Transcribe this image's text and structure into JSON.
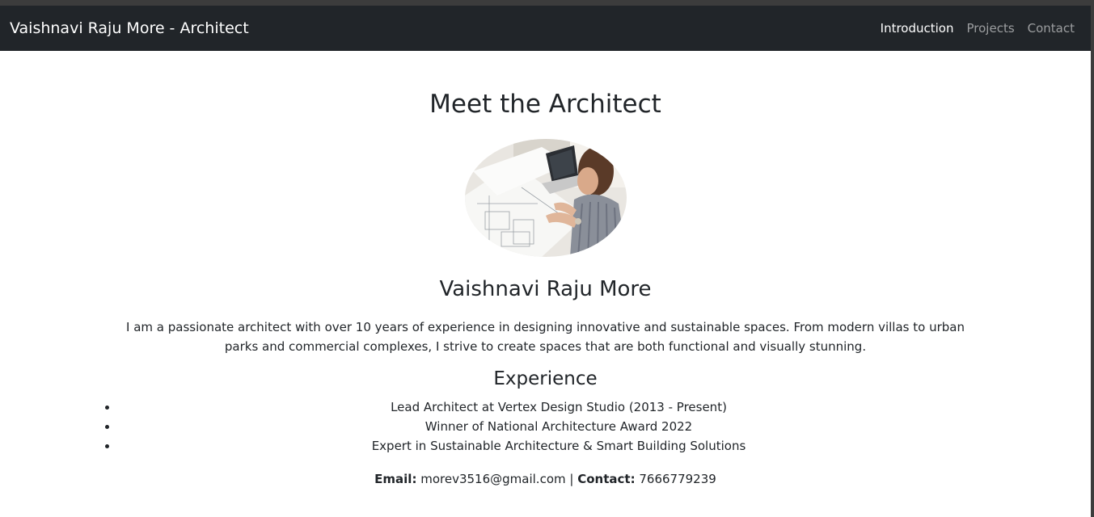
{
  "navbar": {
    "brand": "Vaishnavi Raju More - Architect",
    "links": [
      {
        "label": "Introduction",
        "active": true
      },
      {
        "label": "Projects",
        "active": false
      },
      {
        "label": "Contact",
        "active": false
      }
    ]
  },
  "main": {
    "title": "Meet the Architect",
    "photo_icon": "architect-photo",
    "name": "Vaishnavi Raju More",
    "bio": "I am a passionate architect with over 10 years of experience in designing innovative and sustainable spaces. From modern villas to urban parks and commercial complexes, I strive to create spaces that are both functional and visually stunning.",
    "experience_title": "Experience",
    "experience": [
      "Lead Architect at Vertex Design Studio (2013 - Present)",
      "Winner of National Architecture Award 2022",
      "Expert in Sustainable Architecture & Smart Building Solutions"
    ],
    "contact": {
      "email_label": "Email:",
      "email": "morev3516@gmail.com",
      "separator": "|",
      "phone_label": "Contact:",
      "phone": "7666779239"
    }
  },
  "colors": {
    "navbar_bg": "#212529",
    "text": "#212529",
    "nav_inactive": "rgba(255,255,255,0.55)"
  }
}
